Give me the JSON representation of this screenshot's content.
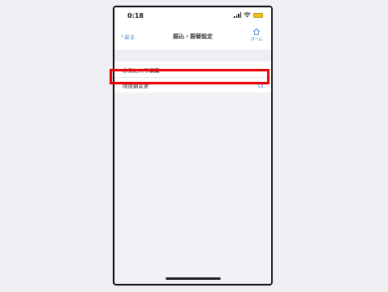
{
  "status_bar": {
    "time": "0:18"
  },
  "nav": {
    "back_label": "戻る",
    "title": "振込・振替設定",
    "home_label": "ホーム"
  },
  "menu": {
    "items": [
      {
        "label": "お気に入り編集",
        "icon": "chevron-right-icon"
      },
      {
        "label": "限度額変更",
        "icon": "external-link-icon"
      }
    ]
  },
  "colors": {
    "accent": "#2f7bd2",
    "highlight": "#e8000b",
    "battery": "#f2c21b"
  }
}
